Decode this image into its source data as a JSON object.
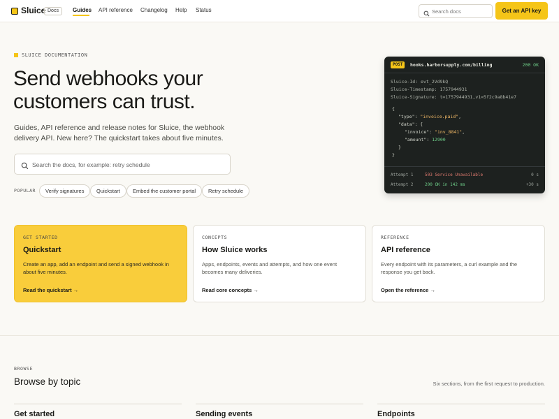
{
  "nav": {
    "brand": "Sluice",
    "badge": "Docs",
    "links": [
      "Guides",
      "API reference",
      "Changelog",
      "Help",
      "Status"
    ],
    "active": "Guides",
    "search_placeholder": "Search docs",
    "cta": "Get an API key"
  },
  "colors": {
    "accent": "#f5c518",
    "code_bg": "#1d211f",
    "success": "#6fd08a",
    "error": "#e07a6f"
  },
  "hero": {
    "eyebrow": "SLUICE DOCUMENTATION",
    "title_line1": "Send webhooks your",
    "title_line2": "customers can trust.",
    "subtitle": "Guides, API reference and release notes for Sluice, the webhook delivery API. New here? The quickstart takes about five minutes.",
    "search_placeholder": "Search the docs, for example: retry schedule",
    "popular_label": "POPULAR",
    "chips": [
      "Verify signatures",
      "Quickstart",
      "Embed the customer portal",
      "Retry schedule"
    ]
  },
  "code_card": {
    "method": "POST",
    "url": "hooks.harborsupply.com/billing",
    "status": "200 OK",
    "headers": [
      "Sluice-Id: evt_2Vd9kQ",
      "Sluice-Timestamp: 1757944931",
      "Sluice-Signature: t=1757944931,v1=5f2c9a8b41e7"
    ],
    "body": {
      "open": "{",
      "type_key": "\"type\"",
      "type_val": "\"invoice.paid\"",
      "data_key": "\"data\"",
      "invoice_key": "\"invoice\"",
      "invoice_val": "\"inv_8841\"",
      "amount_key": "\"amount\"",
      "amount_val": "12900",
      "close_inner": "}",
      "close": "}"
    },
    "attempts": [
      {
        "label": "Attempt 1",
        "status": "503 Service Unavailable",
        "time": "0 s"
      },
      {
        "label": "Attempt 2",
        "status": "200 OK in 142 ms",
        "time": "+30 s"
      }
    ]
  },
  "cards": [
    {
      "kicker": "GET STARTED",
      "title": "Quickstart",
      "desc": "Create an app, add an endpoint and send a signed webhook in about five minutes.",
      "link": "Read the quickstart →"
    },
    {
      "kicker": "CONCEPTS",
      "title": "How Sluice works",
      "desc": "Apps, endpoints, events and attempts, and how one event becomes many deliveries.",
      "link": "Read core concepts →"
    },
    {
      "kicker": "REFERENCE",
      "title": "API reference",
      "desc": "Every endpoint with its parameters, a curl example and the response you get back.",
      "link": "Open the reference →"
    }
  ],
  "browse": {
    "kicker": "BROWSE",
    "title": "Browse by topic",
    "note": "Six sections, from the first request to production.",
    "topics": [
      "Get started",
      "Sending events",
      "Endpoints"
    ]
  }
}
